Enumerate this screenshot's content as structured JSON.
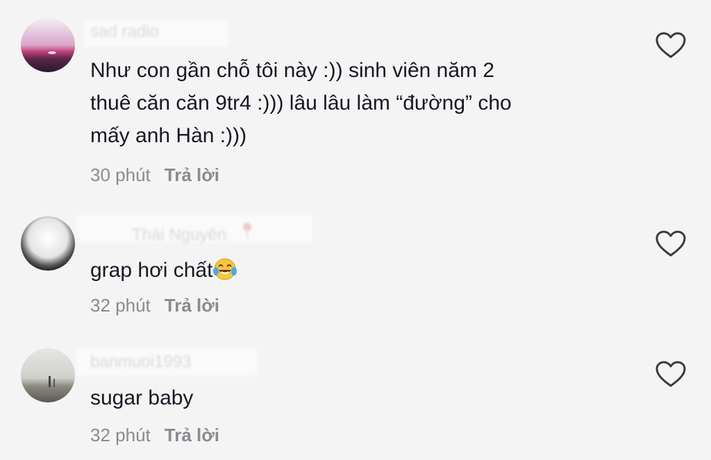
{
  "comments": [
    {
      "username": "sad radio",
      "text_lines": [
        "Như con gần chỗ tôi này :)) sinh viên năm 2",
        "thuê căn căn 9tr4 :))) lâu lâu làm “đường” cho",
        "mấy anh Hàn :)))"
      ],
      "time": "30 phút",
      "reply": "Trả lời",
      "avatar_icon": "sunset-avatar"
    },
    {
      "username": "Thái Nguyên",
      "text": "grap hơi chất",
      "emoji": "tears-of-joy-emoji",
      "time": "32 phút",
      "reply": "Trả lời",
      "avatar_icon": "blurred-avatar"
    },
    {
      "username": "banmuoi1993",
      "text": "sugar baby",
      "time": "32 phút",
      "reply": "Trả lời",
      "avatar_icon": "landscape-avatar"
    }
  ],
  "icons": {
    "like": "heart-outline-icon",
    "pin": "location-pin-icon"
  },
  "colors": {
    "background": "#f4f4f4",
    "text": "#161823",
    "meta": "#8a8b91"
  }
}
